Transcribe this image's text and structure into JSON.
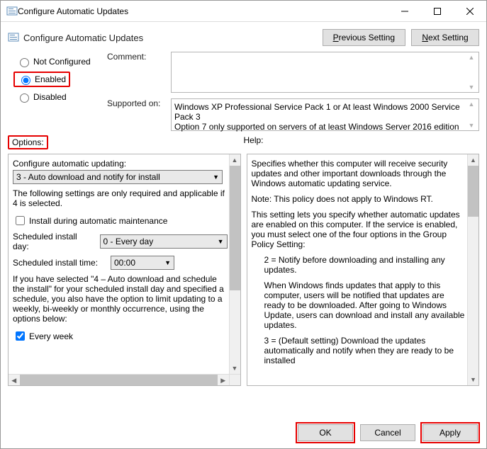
{
  "window": {
    "title": "Configure Automatic Updates"
  },
  "header": {
    "title": "Configure Automatic Updates",
    "previous_btn": "Previous Setting",
    "next_btn": "Next Setting"
  },
  "radios": {
    "not_configured": "Not Configured",
    "enabled": "Enabled",
    "disabled": "Disabled",
    "comment_label": "Comment:",
    "supported_label": "Supported on:",
    "supported_text": "Windows XP Professional Service Pack 1 or At least Windows 2000 Service Pack 3\nOption 7 only supported on servers of at least Windows Server 2016 edition"
  },
  "sections": {
    "options_label": "Options:",
    "help_label": "Help:"
  },
  "options": {
    "configure_label": "Configure automatic updating:",
    "configure_value": "3 - Auto download and notify for install",
    "applicable_note": "The following settings are only required and applicable if 4 is selected.",
    "install_maintenance": "Install during automatic maintenance",
    "sched_day_label": "Scheduled install day:",
    "sched_day_value": "0 - Every day",
    "sched_time_label": "Scheduled install time:",
    "sched_time_value": "00:00",
    "long_note": "If you have selected \"4 – Auto download and schedule the install\" for your scheduled install day and specified a schedule, you also have the option to limit updating to a weekly, bi-weekly or monthly occurrence, using the options below:",
    "every_week": "Every week"
  },
  "help": {
    "p1": "Specifies whether this computer will receive security updates and other important downloads through the Windows automatic updating service.",
    "p2": "Note: This policy does not apply to Windows RT.",
    "p3": "This setting lets you specify whether automatic updates are enabled on this computer. If the service is enabled, you must select one of the four options in the Group Policy Setting:",
    "p4": "2 = Notify before downloading and installing any updates.",
    "p5": "When Windows finds updates that apply to this computer, users will be notified that updates are ready to be downloaded. After going to Windows Update, users can download and install any available updates.",
    "p6": "3 = (Default setting) Download the updates automatically and notify when they are ready to be installed"
  },
  "footer": {
    "ok": "OK",
    "cancel": "Cancel",
    "apply": "Apply"
  }
}
